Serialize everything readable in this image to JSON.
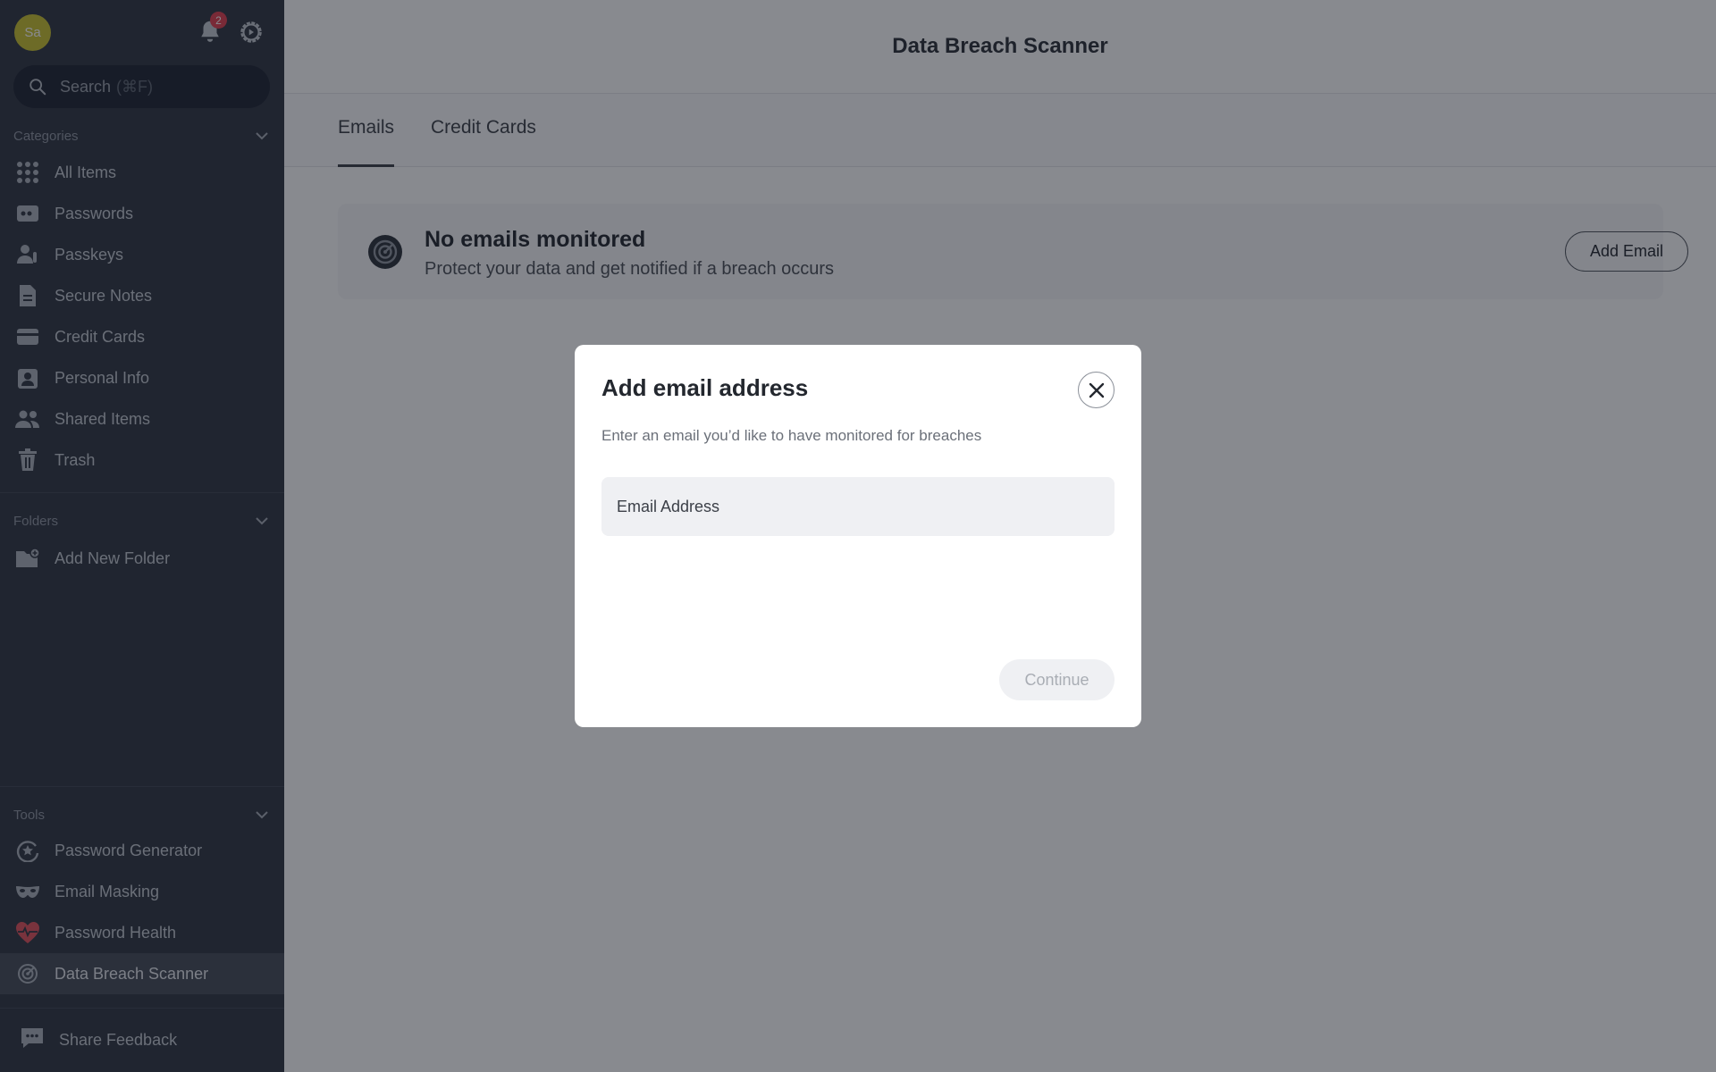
{
  "sidebar": {
    "avatar_initials": "Sa",
    "notification_count": "2",
    "search": {
      "placeholder": "Search",
      "shortcut": "(⌘F)"
    },
    "categories": {
      "heading": "Categories",
      "items": [
        {
          "label": "All Items",
          "icon": "grid-icon"
        },
        {
          "label": "Passwords",
          "icon": "password-card-icon"
        },
        {
          "label": "Passkeys",
          "icon": "passkey-icon"
        },
        {
          "label": "Secure Notes",
          "icon": "note-icon"
        },
        {
          "label": "Credit Cards",
          "icon": "credit-card-icon"
        },
        {
          "label": "Personal Info",
          "icon": "id-badge-icon"
        },
        {
          "label": "Shared Items",
          "icon": "users-icon"
        },
        {
          "label": "Trash",
          "icon": "trash-icon"
        }
      ]
    },
    "folders": {
      "heading": "Folders",
      "add_label": "Add New Folder"
    },
    "tools": {
      "heading": "Tools",
      "items": [
        {
          "label": "Password Generator",
          "icon": "generator-icon"
        },
        {
          "label": "Email Masking",
          "icon": "mask-icon"
        },
        {
          "label": "Password Health",
          "icon": "heart-pulse-icon"
        },
        {
          "label": "Data Breach Scanner",
          "icon": "radar-icon",
          "active": true
        }
      ]
    },
    "feedback_label": "Share Feedback"
  },
  "main": {
    "title": "Data Breach Scanner",
    "tabs": [
      {
        "label": "Emails",
        "active": true
      },
      {
        "label": "Credit Cards",
        "active": false
      }
    ],
    "empty_state": {
      "title": "No emails monitored",
      "subtitle": "Protect your data and get notified if a breach occurs",
      "button_label": "Add Email"
    }
  },
  "modal": {
    "title": "Add email address",
    "description": "Enter an email you’d like to have monitored for breaches",
    "input_placeholder": "Email Address",
    "input_value": "",
    "continue_label": "Continue"
  },
  "colors": {
    "sidebar_bg": "#2e3440",
    "active_item_bg": "#444b57",
    "avatar": "#c9c12f",
    "badge": "#e03e4e",
    "health_icon": "#e0505a",
    "overlay": "rgba(18,22,32,0.5)"
  }
}
